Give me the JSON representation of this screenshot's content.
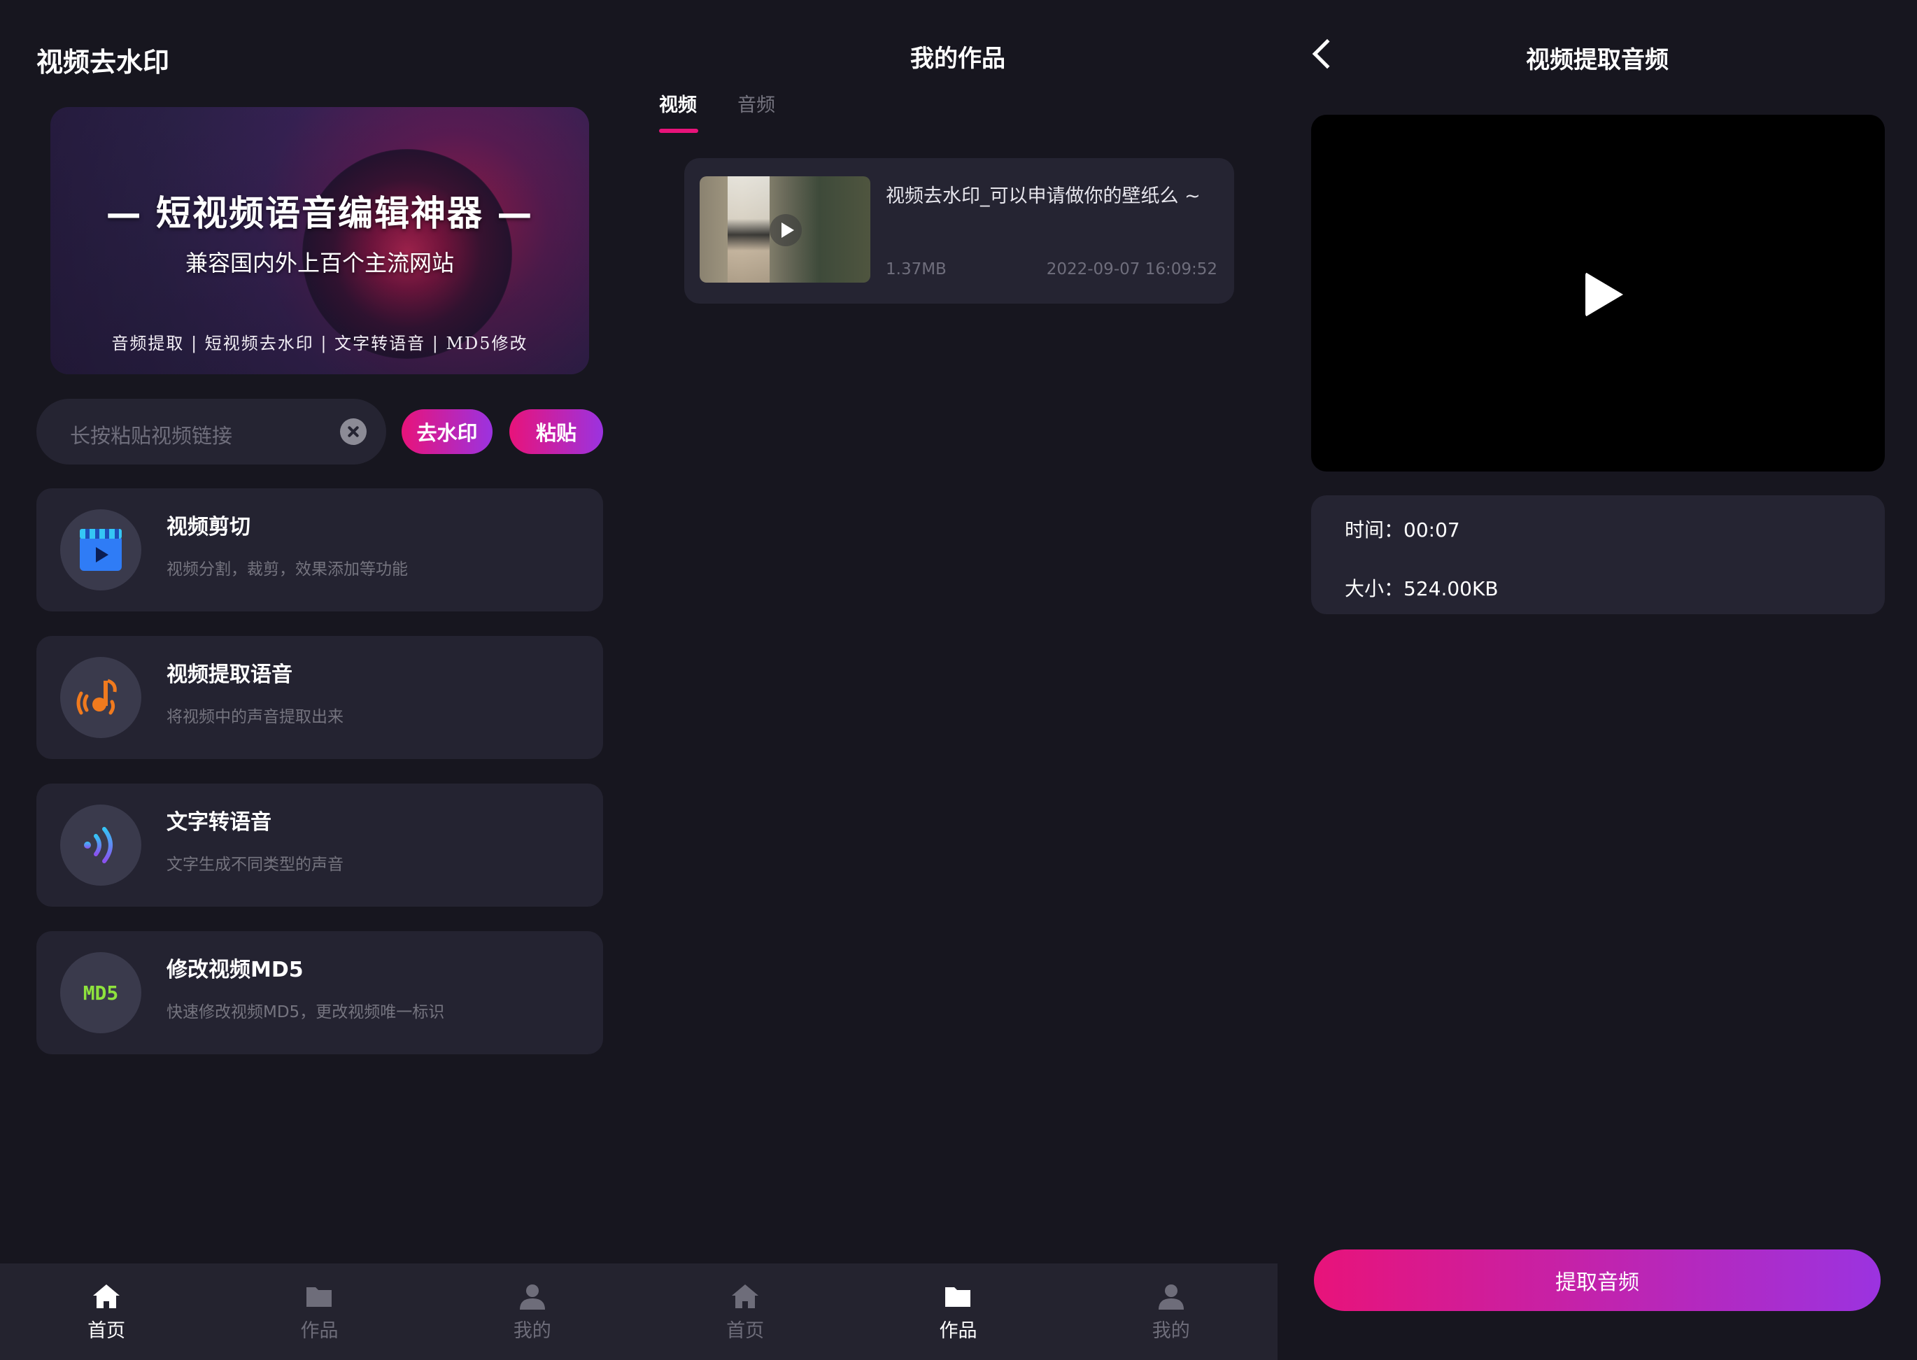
{
  "home": {
    "title": "视频去水印",
    "banner": {
      "headline": "— 短视频语音编辑神器 —",
      "subtitle": "兼容国内外上百个主流网站",
      "features": "音频提取  |  短视频去水印  |  文字转语音  |  MD5修改"
    },
    "search": {
      "placeholder": "长按粘贴视频链接"
    },
    "buttons": {
      "remove_watermark": "去水印",
      "paste": "粘贴"
    },
    "features": [
      {
        "title": "视频剪切",
        "desc": "视频分割，裁剪，效果添加等功能",
        "icon": "video-clapper-icon"
      },
      {
        "title": "视频提取语音",
        "desc": "将视频中的声音提取出来",
        "icon": "music-note-icon"
      },
      {
        "title": "文字转语音",
        "desc": "文字生成不同类型的声音",
        "icon": "sound-wave-icon"
      },
      {
        "title": "修改视频MD5",
        "desc": "快速修改视频MD5，更改视频唯一标识",
        "icon": "md5-icon",
        "icon_text": "MD5"
      }
    ]
  },
  "works": {
    "title": "我的作品",
    "tabs": [
      {
        "label": "视频",
        "active": true
      },
      {
        "label": "音频",
        "active": false
      }
    ],
    "items": [
      {
        "title": "视频去水印_可以申请做你的壁纸么 ~",
        "size": "1.37MB",
        "date": "2022-09-07 16:09:52"
      }
    ]
  },
  "extract": {
    "title": "视频提取音频",
    "time": "时间：00:07",
    "size": "大小：524.00KB",
    "button": "提取音频"
  },
  "bottom_nav_left": [
    {
      "label": "首页",
      "icon": "home-icon",
      "active": true
    },
    {
      "label": "作品",
      "icon": "folder-icon",
      "active": false
    },
    {
      "label": "我的",
      "icon": "user-icon",
      "active": false
    }
  ],
  "bottom_nav_right": [
    {
      "label": "首页",
      "icon": "home-icon",
      "active": false
    },
    {
      "label": "作品",
      "icon": "folder-icon",
      "active": true
    },
    {
      "label": "我的",
      "icon": "user-icon",
      "active": false
    }
  ],
  "colors": {
    "background": "#17161f",
    "card": "#242331",
    "accent_start": "#e8137a",
    "accent_end": "#9b33e0",
    "muted_text": "#75747f"
  }
}
